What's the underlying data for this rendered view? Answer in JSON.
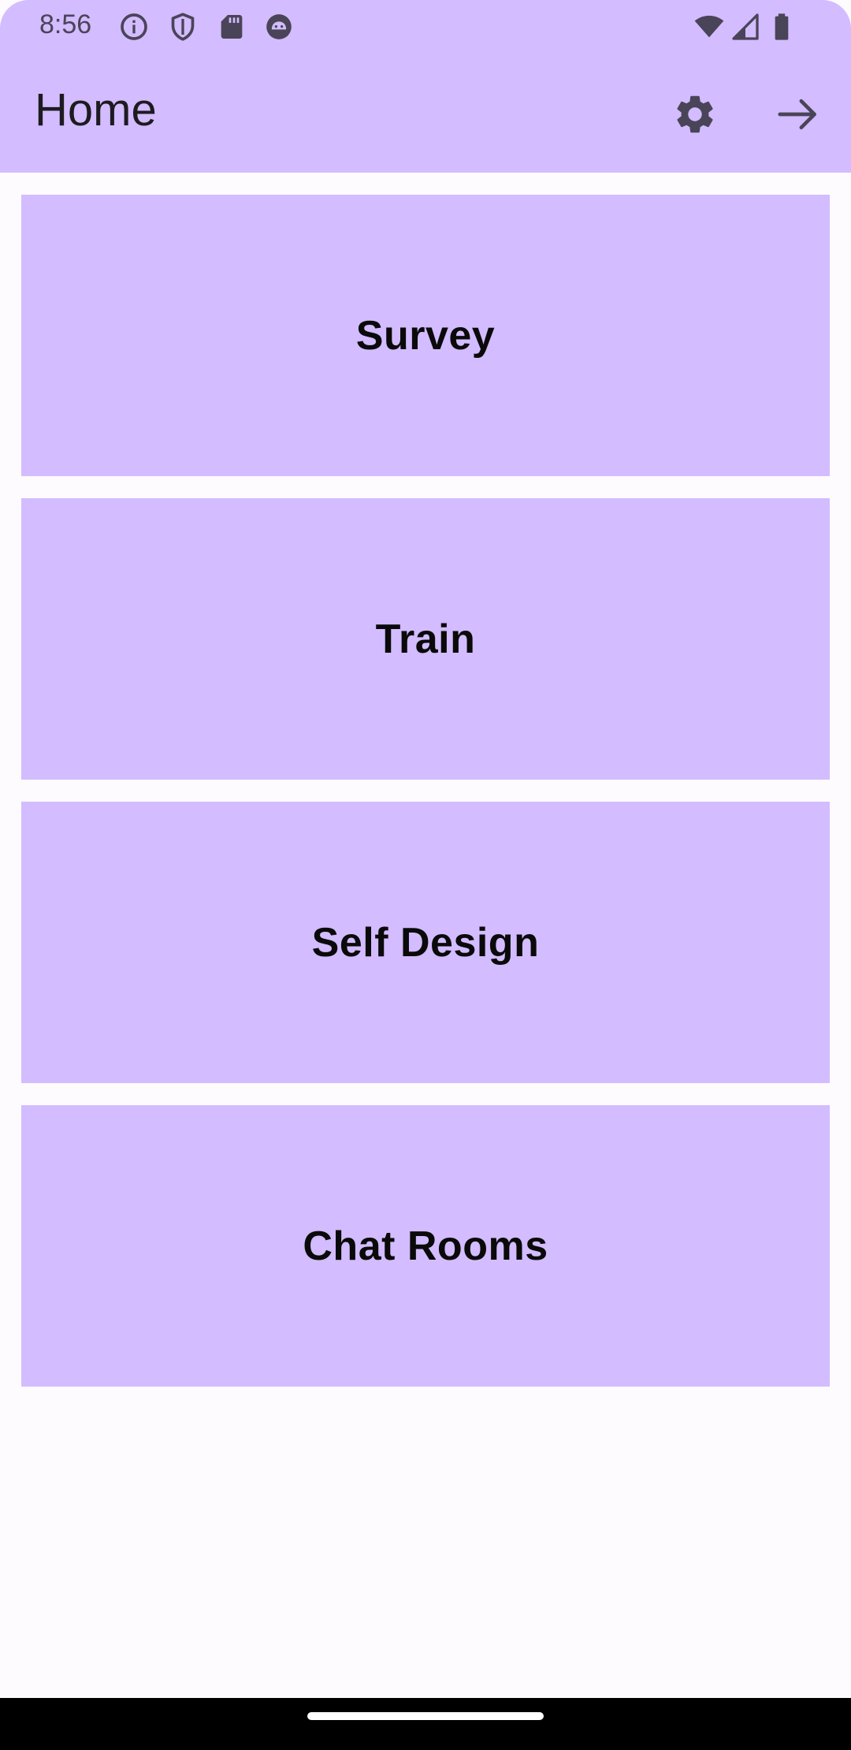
{
  "status_bar": {
    "time": "8:56",
    "left_icons": [
      "info-icon",
      "shield-icon",
      "sd-card-icon",
      "android-face-icon"
    ],
    "right_icons": [
      "wifi-icon",
      "cellular-signal-icon",
      "battery-icon"
    ]
  },
  "app_bar": {
    "title": "Home",
    "actions": [
      "settings-icon",
      "arrow-forward-icon"
    ]
  },
  "menu": {
    "items": [
      {
        "label": "Survey"
      },
      {
        "label": "Train"
      },
      {
        "label": "Self Design"
      },
      {
        "label": "Chat Rooms"
      }
    ]
  },
  "colors": {
    "primary_container": "#d3bcff",
    "background": "#fefbff",
    "on_surface": "#1d1b20",
    "icon": "#4a4458"
  }
}
